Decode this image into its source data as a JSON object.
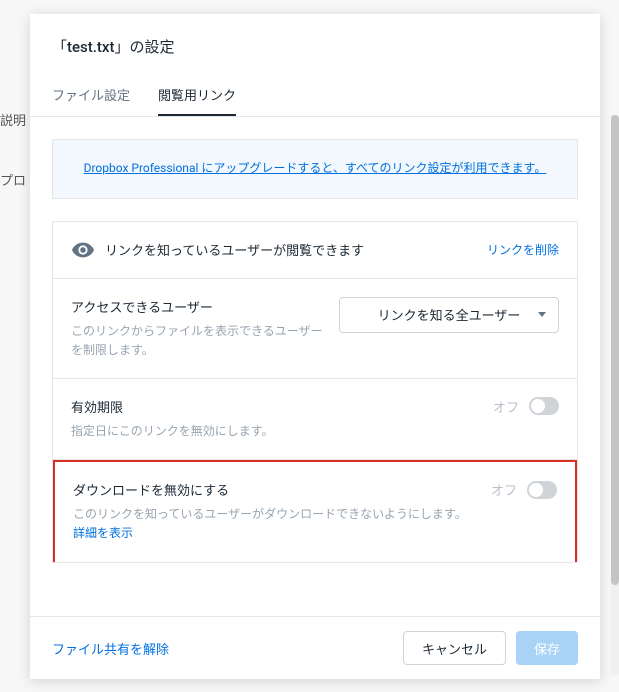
{
  "background": {
    "text1": "説明",
    "text2": "プロ"
  },
  "modal": {
    "title": "「test.txt」の設定",
    "tabs": {
      "file_settings": "ファイル設定",
      "view_link": "閲覧用リンク"
    },
    "upgrade_banner": "Dropbox Professional にアップグレードすると、すべてのリンク設定が利用できます。",
    "section": {
      "header_text": "リンクを知っているユーザーが閲覧できます",
      "remove_link": "リンクを削除",
      "access": {
        "title": "アクセスできるユーザー",
        "desc": "このリンクからファイルを表示できるユーザーを制限します。",
        "dropdown_value": "リンクを知る全ユーザー"
      },
      "expiration": {
        "title": "有効期限",
        "desc": "指定日にこのリンクを無効にします。",
        "toggle_label": "オフ"
      },
      "download_disable": {
        "title": "ダウンロードを無効にする",
        "desc_part1": "このリンクを知っているユーザーがダウンロードできないようにします。",
        "desc_link": "詳細を表示",
        "toggle_label": "オフ"
      }
    },
    "footer": {
      "unshare_link": "ファイル共有を解除",
      "cancel": "キャンセル",
      "save": "保存"
    }
  }
}
